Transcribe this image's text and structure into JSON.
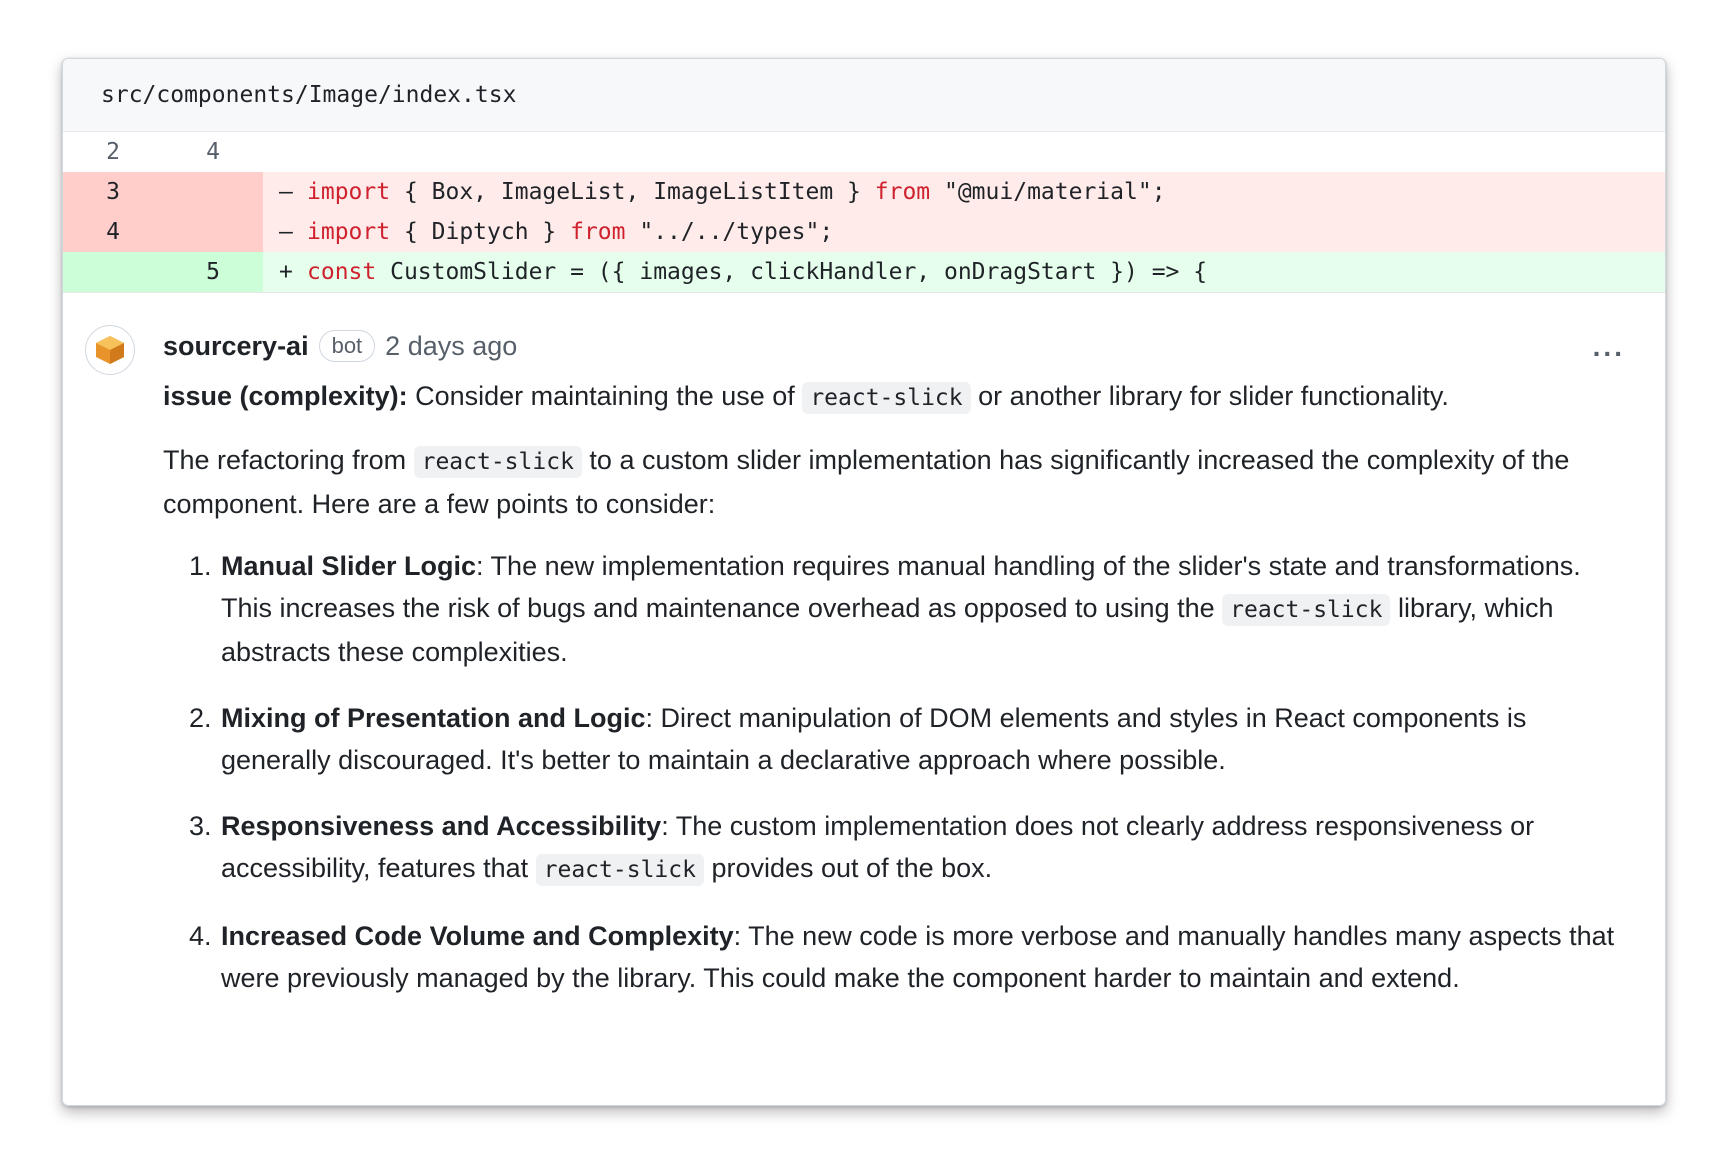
{
  "file": {
    "path": "src/components/Image/index.tsx"
  },
  "diff": {
    "context_row": {
      "old": "2",
      "new": "4"
    },
    "deleted": [
      {
        "old": "3",
        "marker": "–",
        "kw1": "import",
        "mid": " { Box, ImageList, ImageListItem } ",
        "kw2": "from",
        "tail": " \"@mui/material\";"
      },
      {
        "old": "4",
        "marker": "–",
        "kw1": "import",
        "mid": " { Diptych } ",
        "kw2": "from",
        "tail": " \"../../types\";"
      }
    ],
    "added": [
      {
        "new": "5",
        "marker": "+",
        "kw1": "const",
        "tail": " CustomSlider = ({ images, clickHandler, onDragStart }) => {"
      }
    ]
  },
  "comment": {
    "author": "sourcery-ai",
    "badge": "bot",
    "time": "2 days ago",
    "more": "...",
    "issue_label": "issue (complexity):",
    "issue_text_1": " Consider maintaining the use of ",
    "issue_code": "react-slick",
    "issue_text_2": " or another library for slider functionality.",
    "intro_1": "The refactoring from ",
    "intro_code": "react-slick",
    "intro_2": " to a custom slider implementation has significantly increased the complexity of the component. Here are a few points to consider:",
    "points": [
      {
        "title": "Manual Slider Logic",
        "t1": ": The new implementation requires manual handling of the slider's state and transformations. This increases the risk of bugs and maintenance overhead as opposed to using the ",
        "code": "react-slick",
        "t2": " library, which abstracts these complexities."
      },
      {
        "title": "Mixing of Presentation and Logic",
        "t1": ": Direct manipulation of DOM elements and styles in React components is generally discouraged. It's better to maintain a declarative approach where possible."
      },
      {
        "title": "Responsiveness and Accessibility",
        "t1": ": The custom implementation does not clearly address responsiveness or accessibility, features that ",
        "code": "react-slick",
        "t2": " provides out of the box."
      },
      {
        "title": "Increased Code Volume and Complexity",
        "t1": ": The new code is more verbose and manually handles many aspects that were previously managed by the library. This could make the component harder to maintain and extend."
      }
    ]
  },
  "colors": {
    "deleted_bg": "#ffebe9",
    "added_bg": "#e6ffec",
    "keyword": "#cf222e",
    "avatar": "#f0a030"
  }
}
